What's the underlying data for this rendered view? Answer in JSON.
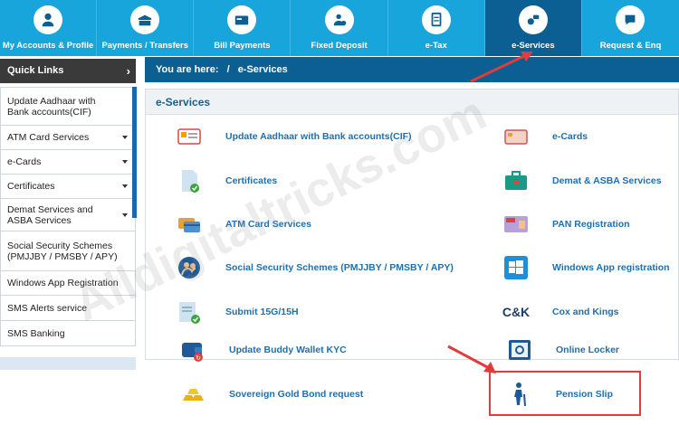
{
  "topnav": {
    "items": [
      {
        "label": "My Accounts & Profile",
        "icon": "person-icon"
      },
      {
        "label": "Payments / Transfers",
        "icon": "transfer-icon"
      },
      {
        "label": "Bill Payments",
        "icon": "bill-icon"
      },
      {
        "label": "Fixed Deposit",
        "icon": "deposit-icon"
      },
      {
        "label": "e-Tax",
        "icon": "tax-doc-icon"
      },
      {
        "label": "e-Services",
        "icon": "eservices-icon",
        "active": true
      },
      {
        "label": "Request & Enq",
        "icon": "request-icon"
      }
    ]
  },
  "sidebar": {
    "title": "Quick Links",
    "items": [
      {
        "label": "Update Aadhaar with Bank accounts(CIF)",
        "dropdown": false
      },
      {
        "label": "ATM Card Services",
        "dropdown": true
      },
      {
        "label": "e-Cards",
        "dropdown": true
      },
      {
        "label": "Certificates",
        "dropdown": true
      },
      {
        "label": "Demat Services and ASBA Services",
        "dropdown": true
      },
      {
        "label": "Social Security Schemes (PMJJBY / PMSBY / APY)",
        "dropdown": false
      },
      {
        "label": "Windows App Registration",
        "dropdown": false
      },
      {
        "label": "SMS Alerts service",
        "dropdown": false
      },
      {
        "label": "SMS Banking",
        "dropdown": false
      }
    ]
  },
  "breadcrumb": {
    "prefix": "You are here:",
    "separator": "/",
    "current": "e-Services"
  },
  "panel": {
    "title": "e-Services",
    "left": [
      {
        "label": "Update Aadhaar with Bank accounts(CIF)",
        "icon": "aadhaar-card-icon"
      },
      {
        "label": "Certificates",
        "icon": "certificate-icon"
      },
      {
        "label": "ATM Card Services",
        "icon": "atm-card-icon"
      },
      {
        "label": "Social Security Schemes (PMJJBY / PMSBY / APY)",
        "icon": "social-security-icon"
      },
      {
        "label": "Submit 15G/15H",
        "icon": "form-submit-icon"
      },
      {
        "label": "Update Buddy Wallet KYC",
        "icon": "wallet-icon"
      },
      {
        "label": "Sovereign Gold Bond request",
        "icon": "gold-bond-icon"
      }
    ],
    "right": [
      {
        "label": "e-Cards",
        "icon": "ecard-icon"
      },
      {
        "label": "Demat & ASBA Services",
        "icon": "briefcase-icon"
      },
      {
        "label": "PAN Registration",
        "icon": "pan-card-icon"
      },
      {
        "label": "Windows App registration",
        "icon": "windows-icon"
      },
      {
        "label": "Cox and Kings",
        "icon": "cox-kings-logo",
        "logo_text": "C&K"
      },
      {
        "label": "Online Locker",
        "icon": "locker-icon"
      },
      {
        "label": "Pension Slip",
        "icon": "elderly-person-icon"
      }
    ]
  },
  "watermark": "Alldigitaltricks.com",
  "colors": {
    "nav_bg": "#17a5dc",
    "nav_active": "#0b5f92",
    "link": "#1d6fb0",
    "annotation": "#e23b3b"
  }
}
